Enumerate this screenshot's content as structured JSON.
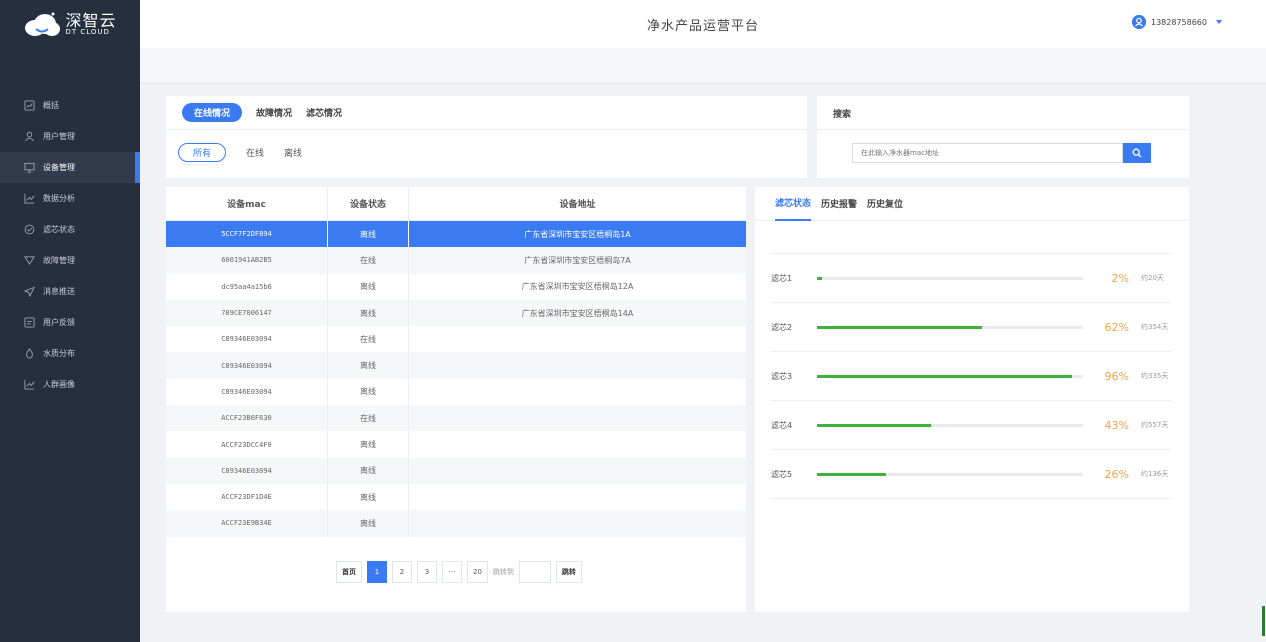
{
  "brand": {
    "name": "深智云",
    "sub": "DT CLOUD"
  },
  "header": {
    "title": "净水产品运营平台",
    "user": "13828758660"
  },
  "sidebar": {
    "items": [
      {
        "label": "概括",
        "icon": "chart-box-icon"
      },
      {
        "label": "用户管理",
        "icon": "user-icon"
      },
      {
        "label": "设备管理",
        "icon": "monitor-icon",
        "active": true
      },
      {
        "label": "数据分析",
        "icon": "trend-icon"
      },
      {
        "label": "滤芯状态",
        "icon": "check-circle-icon"
      },
      {
        "label": "故障管理",
        "icon": "funnel-icon"
      },
      {
        "label": "消息推送",
        "icon": "send-icon"
      },
      {
        "label": "用户反馈",
        "icon": "feedback-icon"
      },
      {
        "label": "水质分布",
        "icon": "drop-icon"
      },
      {
        "label": "人群画像",
        "icon": "trend-icon"
      }
    ]
  },
  "status_panel": {
    "tabs": [
      "在线情况",
      "故障情况",
      "滤芯情况"
    ],
    "filters": [
      "所有",
      "在线",
      "离线"
    ]
  },
  "search": {
    "title": "搜索",
    "placeholder": "在此输入净水器mac地址"
  },
  "device_table": {
    "headers": [
      "设备mac",
      "设备状态",
      "设备地址"
    ],
    "rows": [
      [
        "5CCF7F2DF894",
        "离线",
        "广东省深圳市宝安区梧桐岛1A"
      ],
      [
        "6001941AB2B5",
        "在线",
        "广东省深圳市宝安区梧桐岛7A"
      ],
      [
        "dc95aa4a15b6",
        "离线",
        "广东省深圳市宝安区梧桐岛12A"
      ],
      [
        "789CE7006147",
        "离线",
        "广东省深圳市宝安区梧桐岛14A"
      ],
      [
        "C89346E03094",
        "在线",
        ""
      ],
      [
        "C89346E03094",
        "离线",
        ""
      ],
      [
        "C89346E03094",
        "离线",
        ""
      ],
      [
        "ACCF23B6F630",
        "在线",
        ""
      ],
      [
        "ACCF23DCC4F0",
        "离线",
        ""
      ],
      [
        "C89346E03094",
        "离线",
        ""
      ],
      [
        "ACCF23DF1D4E",
        "离线",
        ""
      ],
      [
        "ACCF23E9B34E",
        "离线",
        ""
      ]
    ],
    "selected_row": 0
  },
  "pagination": {
    "first": "首页",
    "pages": [
      "1",
      "2",
      "3"
    ],
    "ellipsis": "···",
    "last": "20",
    "jump_label": "跳转到",
    "jump_button": "跳转",
    "current": "1"
  },
  "filter_panel": {
    "tabs": [
      "滤芯状态",
      "历史报警",
      "历史复位"
    ],
    "filters": [
      {
        "name": "滤芯1",
        "percent": 2,
        "percent_label": "2%",
        "days": "约20天"
      },
      {
        "name": "滤芯2",
        "percent": 62,
        "percent_label": "62%",
        "days": "约354天"
      },
      {
        "name": "滤芯3",
        "percent": 96,
        "percent_label": "96%",
        "days": "约335天"
      },
      {
        "name": "滤芯4",
        "percent": 43,
        "percent_label": "43%",
        "days": "约557天"
      },
      {
        "name": "滤芯5",
        "percent": 26,
        "percent_label": "26%",
        "days": "约136天"
      }
    ]
  },
  "colors": {
    "accent": "#3a7bf2",
    "sidebar": "#262f3d",
    "progress": "#3db33d",
    "percent": "#f0a648"
  }
}
